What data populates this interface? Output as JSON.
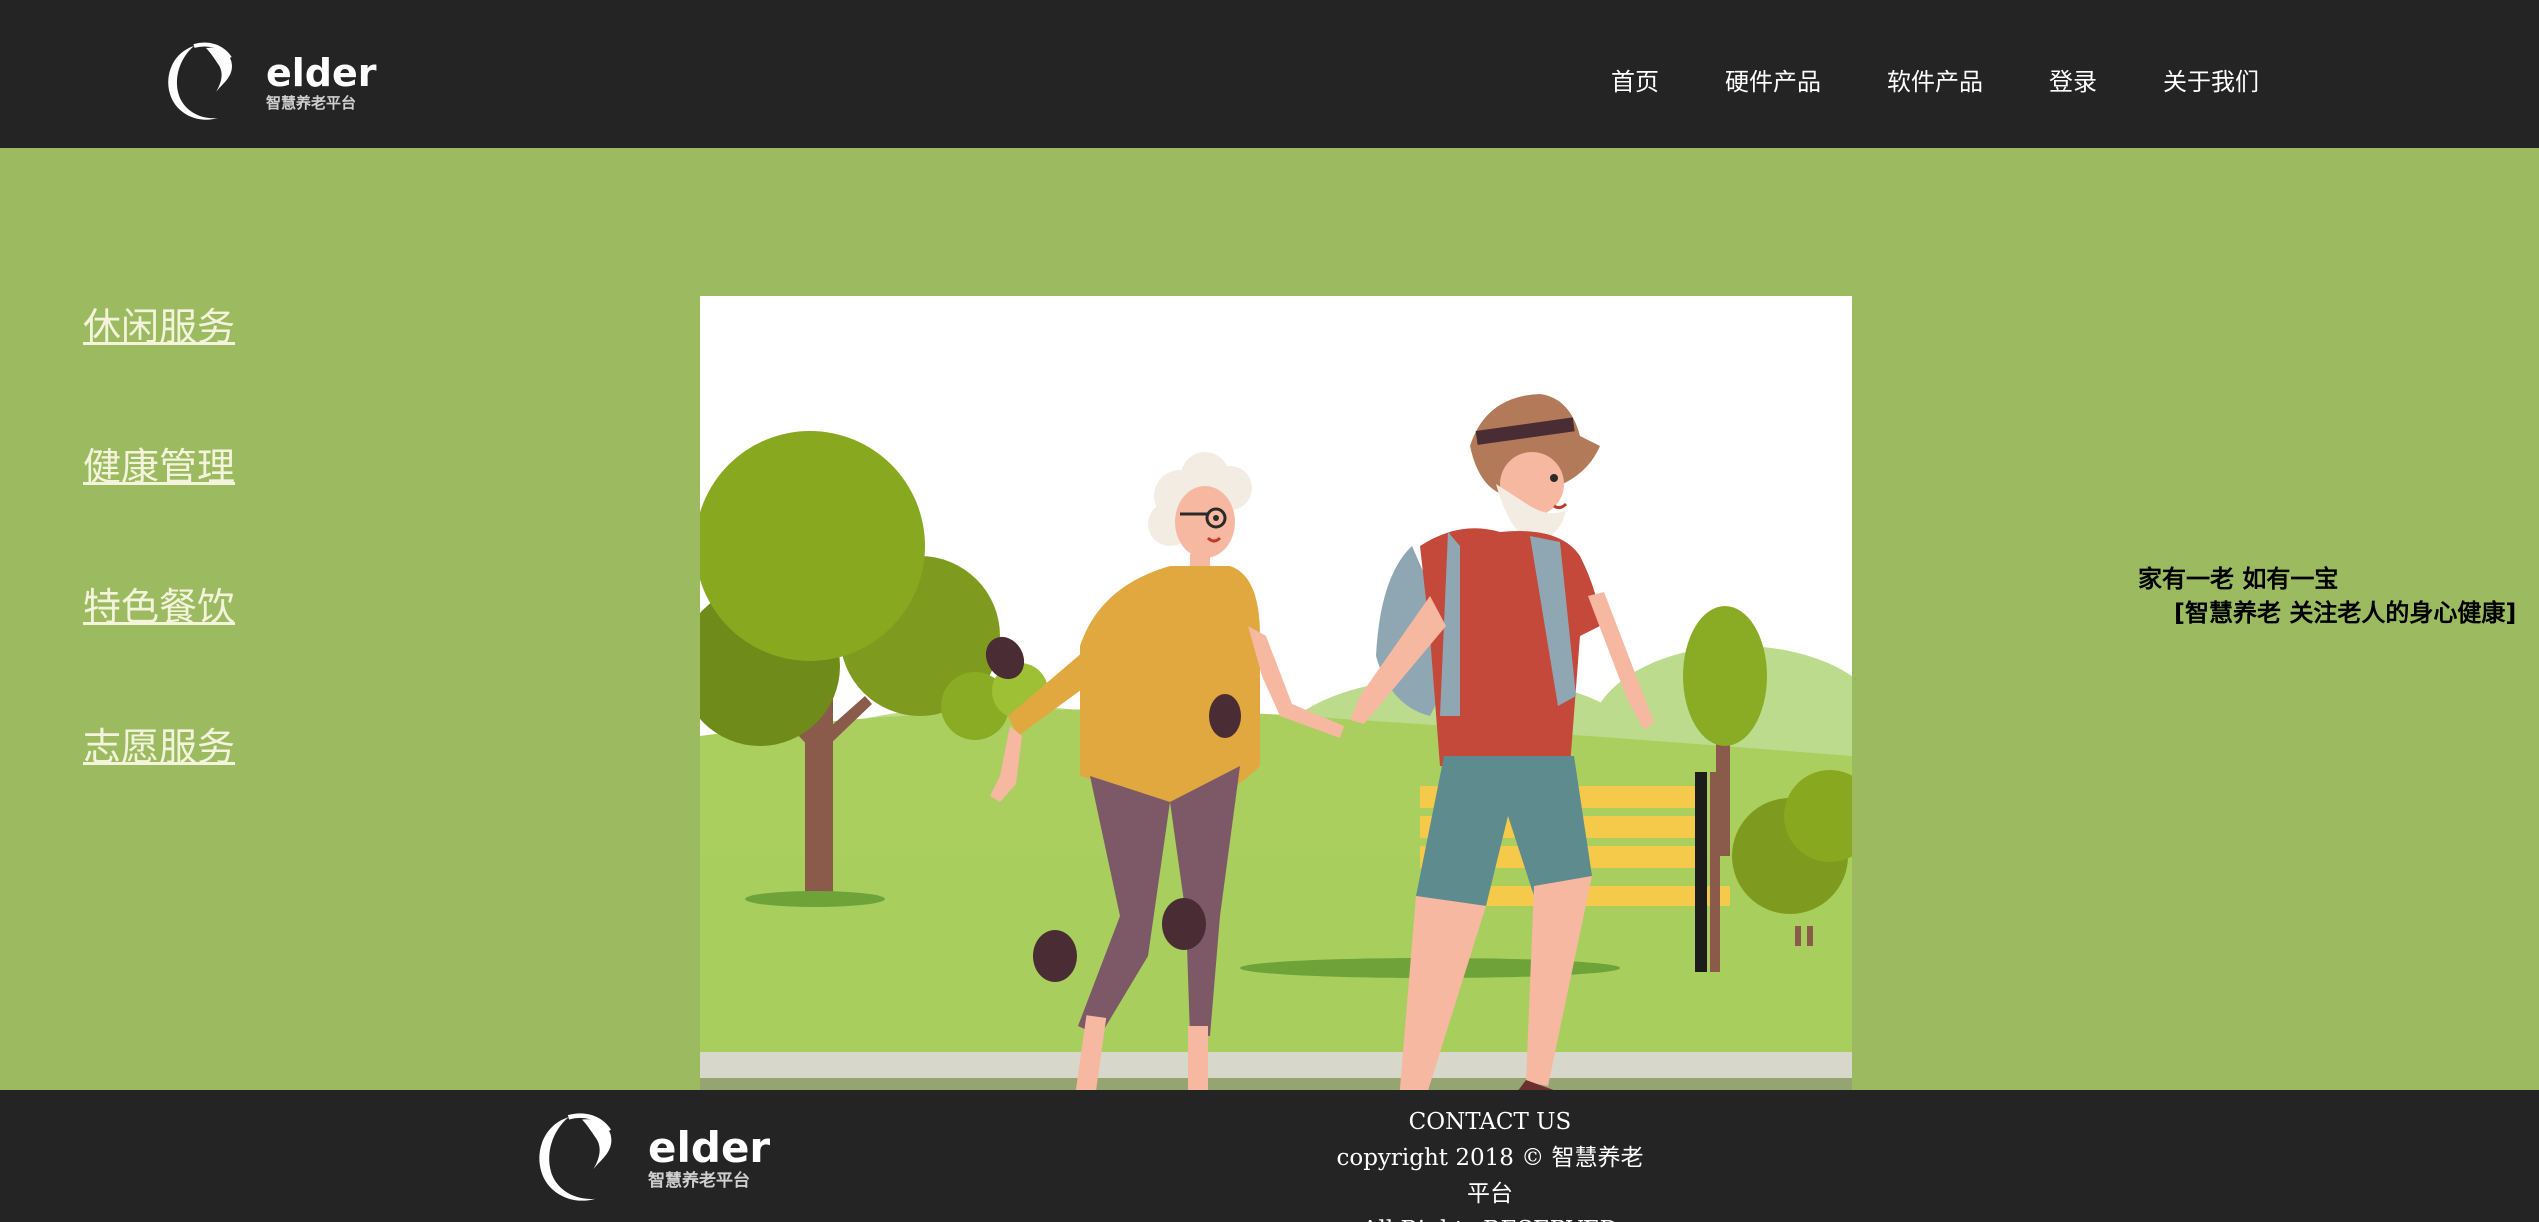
{
  "header": {
    "logo": {
      "word": "elder",
      "sub": "智慧养老平台"
    },
    "nav": [
      {
        "label": "首页"
      },
      {
        "label": "硬件产品"
      },
      {
        "label": "软件产品"
      },
      {
        "label": "登录"
      },
      {
        "label": "关于我们"
      }
    ]
  },
  "side_menu": [
    {
      "label": "休闲服务"
    },
    {
      "label": "健康管理"
    },
    {
      "label": "特色餐饮"
    },
    {
      "label": "志愿服务"
    }
  ],
  "hero": {
    "illustration": "elderly-couple-rollerblading-in-park"
  },
  "tagline": {
    "line1": "家有一老  如有一宝",
    "line2": "[智慧养老  关注老人的身心健康]"
  },
  "footer": {
    "logo": {
      "word": "elder",
      "sub": "智慧养老平台"
    },
    "contact": "CONTACT US",
    "copyright": "copyright 2018 © 智慧养老平台",
    "rights": "All Rights RESERVED"
  },
  "colors": {
    "header_bg": "#242424",
    "page_bg": "#9cbb61",
    "menu_link": "#f4f4dc"
  }
}
